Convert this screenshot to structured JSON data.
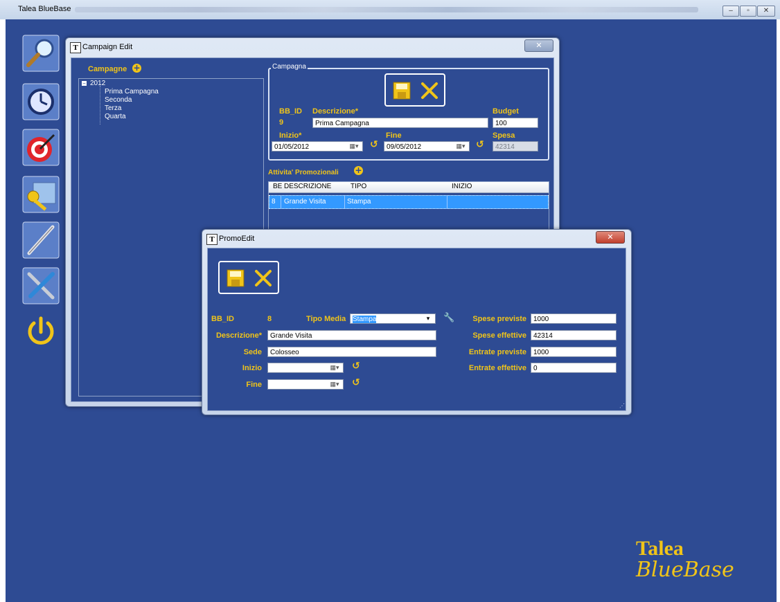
{
  "app": {
    "title": "Talea BlueBase",
    "logo_line1": "Talea",
    "logo_line2": "BlueBase"
  },
  "sidebar": {
    "icons": [
      "search-icon",
      "clock-icon",
      "target-icon",
      "keys-folder-icon",
      "pen-icon",
      "tools-icon",
      "power-icon"
    ]
  },
  "campaign_edit": {
    "title": "Campaign Edit",
    "campagne_label": "Campagne",
    "tree": {
      "year": "2012",
      "items": [
        "Prima Campagna",
        "Seconda",
        "Terza",
        "Quarta"
      ]
    },
    "group_label": "Campagna",
    "bb_id_label": "BB_ID",
    "bb_id_value": "9",
    "descrizione_label": "Descrizione*",
    "descrizione_value": "Prima Campagna",
    "budget_label": "Budget",
    "budget_value": "100",
    "inizio_label": "Inizio*",
    "inizio_value": "01/05/2012",
    "fine_label": "Fine",
    "fine_value": "09/05/2012",
    "spesa_label": "Spesa",
    "spesa_value": "42314",
    "attivita_label": "Attivita' Promozionali",
    "grid": {
      "columns": [
        "BE",
        "DESCRIZIONE",
        "TIPO",
        "INIZIO"
      ],
      "rows": [
        {
          "id": "8",
          "descrizione": "Grande Visita",
          "tipo": "Stampa",
          "inizio": ""
        }
      ]
    }
  },
  "promo_edit": {
    "title": "PromoEdit",
    "bb_id_label": "BB_ID",
    "bb_id_value": "8",
    "tipo_media_label": "Tipo Media",
    "tipo_media_value": "Stampa",
    "descrizione_label": "Descrizione*",
    "descrizione_value": "Grande Visita",
    "sede_label": "Sede",
    "sede_value": "Colosseo",
    "inizio_label": "Inizio",
    "inizio_value": "",
    "fine_label": "Fine",
    "fine_value": "",
    "spese_previste_label": "Spese previste",
    "spese_previste_value": "1000",
    "spese_effettive_label": "Spese effettive",
    "spese_effettive_value": "42314",
    "entrate_previste_label": "Entrate previste",
    "entrate_previste_value": "1000",
    "entrate_effettive_label": "Entrate effettive",
    "entrate_effettive_value": "0"
  },
  "colors": {
    "desktop": "#2e4b93",
    "accent": "#f0c419",
    "selection": "#3399ff"
  }
}
